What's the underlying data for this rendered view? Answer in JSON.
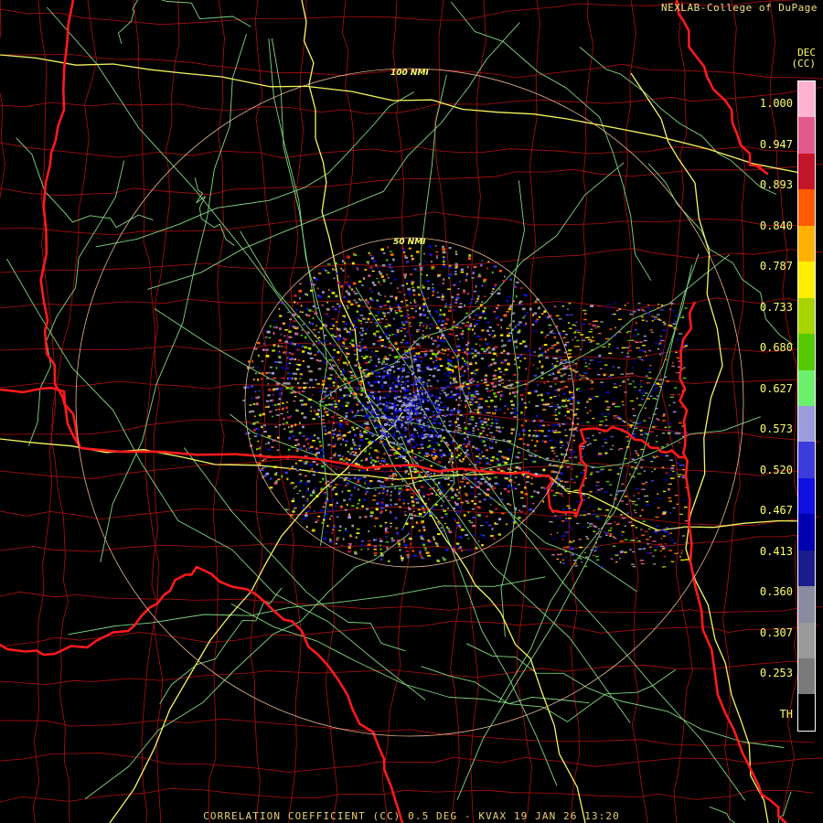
{
  "credit": "NEXLAB-College of DuPage",
  "product_title": "CORRELATION COEFFICIENT (CC) 0.5 DEG - KVAX 19 JAN 26 13:20",
  "colorbar": {
    "unit_line1": "DEC",
    "unit_line2": "(CC)",
    "labels": [
      "1.000",
      "0.947",
      "0.893",
      "0.840",
      "0.787",
      "0.733",
      "0.680",
      "0.627",
      "0.573",
      "0.520",
      "0.467",
      "0.413",
      "0.360",
      "0.307",
      "0.253",
      "TH"
    ],
    "colors": [
      "#ffb3d1",
      "#e05a8a",
      "#c4162a",
      "#ff5a00",
      "#ffb000",
      "#ffee00",
      "#a8d400",
      "#56c800",
      "#6cf06c",
      "#9c9cdc",
      "#3c3cdc",
      "#1010e0",
      "#0000b0",
      "#1c1c8c",
      "#8a8aa0",
      "#9a9a9a",
      "#7a7a7a",
      "#000000"
    ]
  },
  "range_rings": [
    {
      "label": "50 NMI"
    },
    {
      "label": "100 NMI"
    }
  ],
  "colors": {
    "state_border": "#ff1a1a",
    "county_border": "#b01010",
    "highway_interstate": "#f5f560",
    "highway_other": "#80d880",
    "range_ring": "#e8b890"
  }
}
